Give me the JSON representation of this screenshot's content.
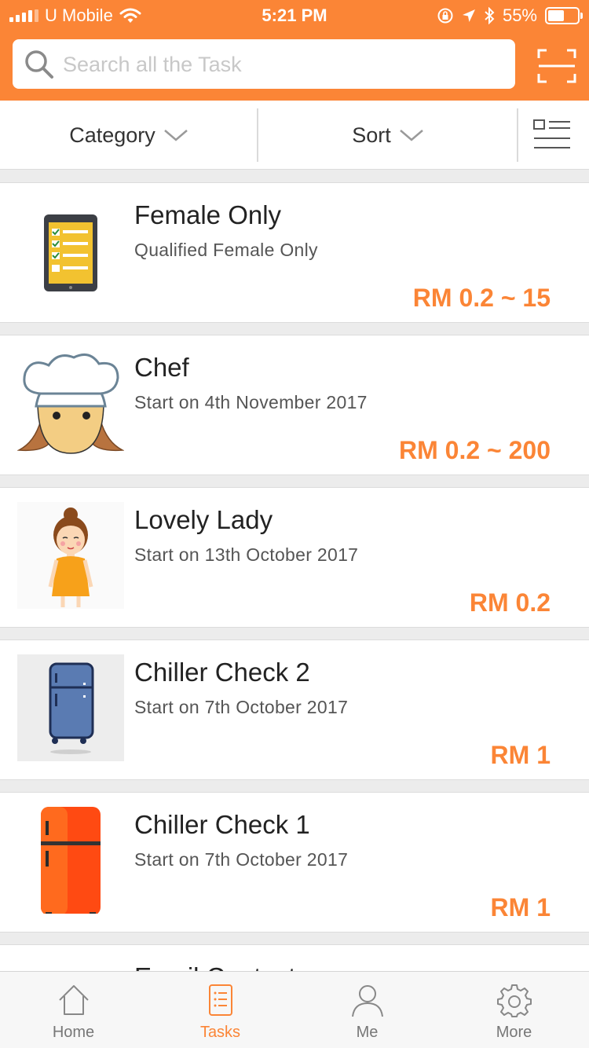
{
  "status_bar": {
    "carrier": "U Mobile",
    "time": "5:21 PM",
    "battery": "55%",
    "battery_level": 0.55
  },
  "search": {
    "placeholder": "Search all the Task"
  },
  "filters": {
    "category_label": "Category",
    "sort_label": "Sort"
  },
  "tasks": [
    {
      "title": "Female Only",
      "subtitle": "Qualified Female Only",
      "price": "RM 0.2 ~ 15",
      "icon": "checklist-tablet-icon"
    },
    {
      "title": "Chef",
      "subtitle": "Start on 4th November 2017",
      "price": "RM 0.2 ~ 200",
      "icon": "chef-icon"
    },
    {
      "title": "Lovely Lady",
      "subtitle": "Start on 13th October 2017",
      "price": "RM 0.2",
      "icon": "lady-icon"
    },
    {
      "title": "Chiller Check 2",
      "subtitle": "Start on 7th October 2017",
      "price": "RM 1",
      "icon": "fridge-blue-icon"
    },
    {
      "title": "Chiller Check 1",
      "subtitle": "Start on 7th October 2017",
      "price": "RM 1",
      "icon": "fridge-orange-icon"
    },
    {
      "title": "Email Contact",
      "subtitle": "",
      "price": "",
      "icon": ""
    }
  ],
  "tabbar": {
    "home": "Home",
    "tasks": "Tasks",
    "me": "Me",
    "more": "More",
    "active": "tasks"
  },
  "colors": {
    "accent": "#fb8536",
    "background": "#ececec"
  }
}
